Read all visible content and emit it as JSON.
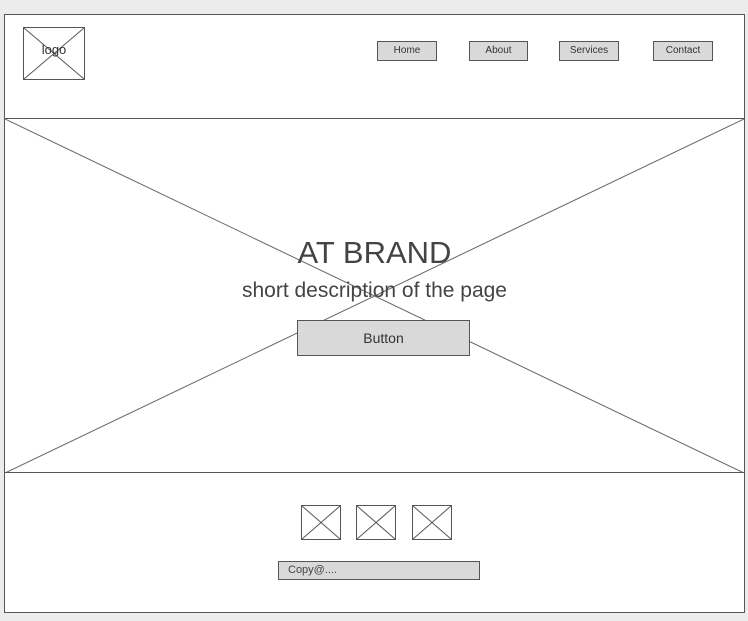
{
  "header": {
    "logo_label": "logo",
    "nav": [
      {
        "label": "Home"
      },
      {
        "label": "About"
      },
      {
        "label": "Services"
      },
      {
        "label": "Contact"
      }
    ]
  },
  "hero": {
    "title": "AT BRAND",
    "description": "short description of the page",
    "button_label": "Button"
  },
  "footer": {
    "social_icons": [
      "image-placeholder-icon",
      "image-placeholder-icon",
      "image-placeholder-icon"
    ],
    "copyright": "Copy@...."
  },
  "colors": {
    "background": "#ececec",
    "canvas": "#ffffff",
    "button_fill": "#d9d9d9",
    "stroke": "#555555",
    "text": "#444444"
  }
}
